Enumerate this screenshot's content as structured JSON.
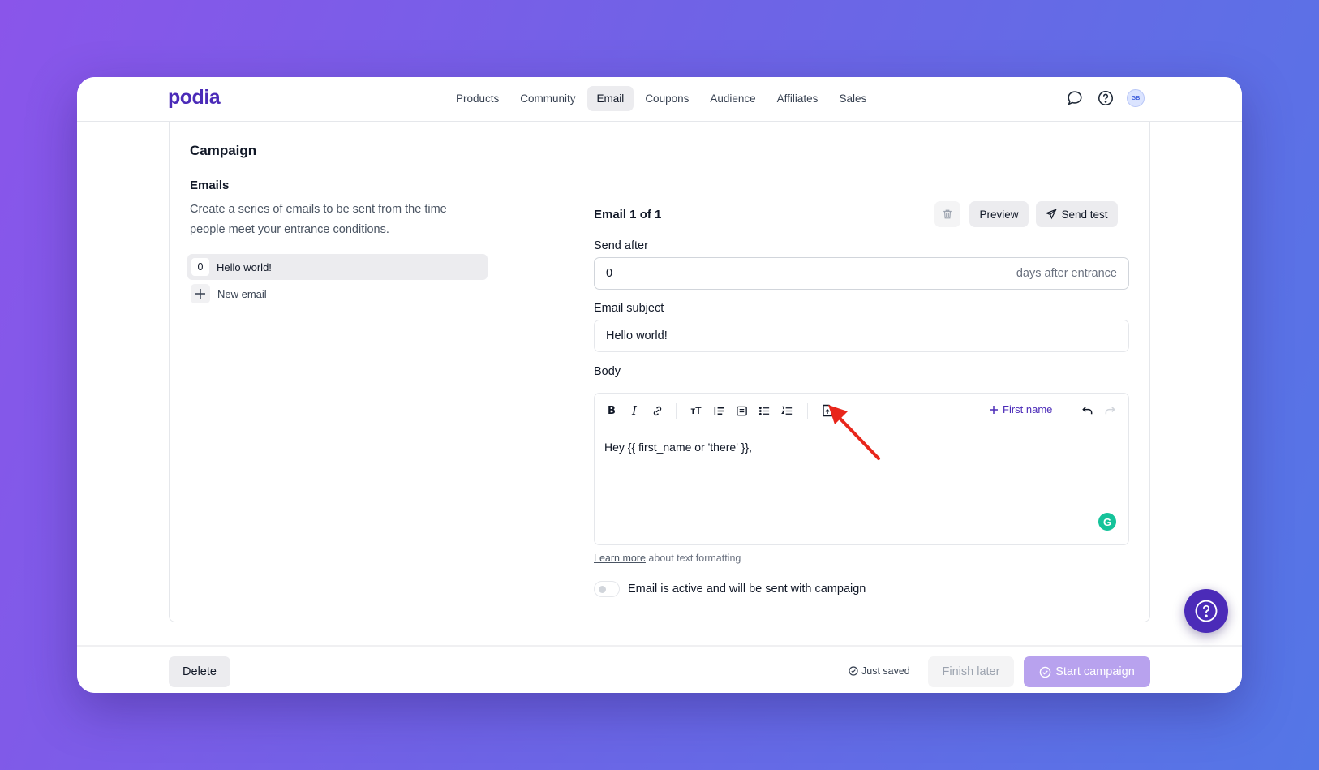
{
  "brand": {
    "logo": "podia",
    "accent": "#4b2bb8"
  },
  "nav": {
    "links": [
      "Products",
      "Community",
      "Email",
      "Coupons",
      "Audience",
      "Affiliates",
      "Sales"
    ],
    "active": "Email",
    "avatar_initials": "GB"
  },
  "campaign": {
    "title": "Campaign",
    "emails_heading": "Emails",
    "emails_description": "Create a series of emails to be sent from the time people meet your entrance conditions.",
    "email_list": [
      {
        "index": "0",
        "label": "Hello world!"
      }
    ],
    "new_email_label": "New email"
  },
  "editor_panel": {
    "header": "Email 1 of 1",
    "preview_label": "Preview",
    "send_test_label": "Send test",
    "send_after_label": "Send after",
    "send_after_value": "0",
    "send_after_suffix": "days after entrance",
    "subject_label": "Email subject",
    "subject_value": "Hello world!",
    "body_label": "Body",
    "first_name_label": "First name",
    "body_text": "Hey {{ first_name or 'there' }},",
    "learn_more_link": "Learn more",
    "learn_more_rest": " about text formatting",
    "toggle_label": "Email is active and will be sent with campaign"
  },
  "footer": {
    "delete_label": "Delete",
    "saved_label": "Just saved",
    "finish_later_label": "Finish later",
    "start_campaign_label": "Start campaign"
  },
  "icons": [
    "chat-icon",
    "help-icon",
    "trash-icon",
    "send-icon",
    "bold-icon",
    "italic-icon",
    "link-icon",
    "text-size-icon",
    "blockquote-icon",
    "embed-icon",
    "bullet-list-icon",
    "numbered-list-icon",
    "upload-file-icon",
    "plus-icon",
    "undo-icon",
    "redo-icon",
    "grammarly-icon",
    "check-circle-icon"
  ],
  "colors": {
    "arrow": "#e8261b",
    "grammarly": "#15c39a",
    "start_button": "#b8a2ee"
  }
}
